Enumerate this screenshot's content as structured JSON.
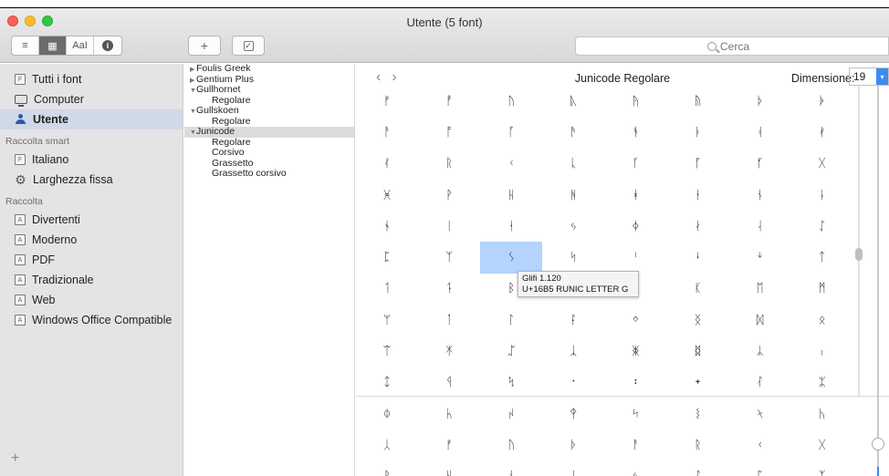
{
  "window": {
    "title": "Utente (5 font)"
  },
  "toolbar": {
    "view_modes": [
      "≡",
      "▦",
      "AaI",
      "i"
    ],
    "add_label": "+",
    "search": {
      "placeholder": "Cerca"
    }
  },
  "sidebar": {
    "items_top": [
      {
        "label": "Tutti i font",
        "icon": "font-file-icon"
      },
      {
        "label": "Computer",
        "icon": "computer-icon"
      },
      {
        "label": "Utente",
        "icon": "user-icon",
        "selected": true
      }
    ],
    "smart_title": "Raccolta smart",
    "smart_items": [
      {
        "label": "Italiano",
        "icon": "font-file-icon"
      },
      {
        "label": "Larghezza fissa",
        "icon": "gear-icon"
      }
    ],
    "collection_title": "Raccolta",
    "collection_items": [
      {
        "label": "Divertenti"
      },
      {
        "label": "Moderno"
      },
      {
        "label": "PDF"
      },
      {
        "label": "Tradizionale"
      },
      {
        "label": "Web"
      },
      {
        "label": "Windows Office Compatible"
      }
    ],
    "add_label": "+"
  },
  "font_list": [
    {
      "type": "family",
      "label": "Foulis Greek",
      "expanded": false
    },
    {
      "type": "family",
      "label": "Gentium Plus",
      "expanded": false
    },
    {
      "type": "family",
      "label": "Gullhornet",
      "expanded": true
    },
    {
      "type": "style",
      "label": "Regolare"
    },
    {
      "type": "family",
      "label": "Gullskoen",
      "expanded": true
    },
    {
      "type": "style",
      "label": "Regolare"
    },
    {
      "type": "family",
      "label": "Junicode",
      "expanded": true,
      "selected": true
    },
    {
      "type": "style",
      "label": "Regolare"
    },
    {
      "type": "style",
      "label": "Corsivo"
    },
    {
      "type": "style",
      "label": "Grassetto"
    },
    {
      "type": "style",
      "label": "Grassetto corsivo"
    }
  ],
  "preview": {
    "nav_prev": "‹",
    "nav_next": "›",
    "font_name": "Junicode Regolare",
    "size_label": "Dimensione:",
    "size_value": "19",
    "glyph_rows": [
      [
        "ᚠ",
        "ᚡ",
        "ᚢ",
        "ᚣ",
        "ᚤ",
        "ᚥ",
        "ᚦ",
        "ᚧ"
      ],
      [
        "ᚨ",
        "ᚩ",
        "ᚪ",
        "ᚫ",
        "ᚬ",
        "ᚭ",
        "ᚮ",
        "ᚯ"
      ],
      [
        "ᚰ",
        "ᚱ",
        "ᚲ",
        "ᚳ",
        "ᚴ",
        "ᚵ",
        "ᚶ",
        "ᚷ"
      ],
      [
        "ᚸ",
        "ᚹ",
        "ᚺ",
        "ᚻ",
        "ᚼ",
        "ᚽ",
        "ᚾ",
        "ᚿ"
      ],
      [
        "ᛀ",
        "ᛁ",
        "ᛂ",
        "ᛃ",
        "ᛄ",
        "ᛅ",
        "ᛆ",
        "ᛇ"
      ],
      [
        "ᛈ",
        "ᛉ",
        "ᛊ",
        "ᛋ",
        "ᛌ",
        "ᛍ",
        "ᛎ",
        "ᛏ"
      ],
      [
        "ᛐ",
        "ᛑ",
        "ᛒ",
        "ᛓ",
        "ᛔ",
        "ᛕ",
        "ᛖ",
        "ᛗ"
      ],
      [
        "ᛘ",
        "ᛙ",
        "ᛚ",
        "ᛛ",
        "ᛜ",
        "ᛝ",
        "ᛞ",
        "ᛟ"
      ],
      [
        "ᛠ",
        "ᛡ",
        "ᛢ",
        "ᛣ",
        "ᛤ",
        "ᛥ",
        "ᛦ",
        "ᛧ"
      ],
      [
        "ᛨ",
        "ᛩ",
        "ᛪ",
        "᛫",
        "᛬",
        "᛭",
        "ᛮ",
        "ᛯ"
      ],
      [
        "ᛰ",
        "ᛱ",
        "ᛲ",
        "ᛳ",
        "ᛴ",
        "ᛵ",
        "ᛶ",
        "ᛷ"
      ],
      [
        "ᛸ",
        "ᚠ",
        "ᚢ",
        "ᚦ",
        "ᚨ",
        "ᚱ",
        "ᚲ",
        "ᚷ"
      ],
      [
        "ᚹ",
        "ᚺ",
        "ᚾ",
        "ᛁ",
        "ᛃ",
        "ᛇ",
        "ᛈ",
        "ᛉ"
      ]
    ],
    "selected_cell": [
      5,
      2
    ],
    "tooltip_line1": "Glifi 1.120",
    "tooltip_line2": "U+16B5 RUNIC LETTER G"
  },
  "colors": {
    "accent": "#3b8cf2",
    "selection": "#b3d4fc",
    "sidebar_bg": "#e4e3e5"
  }
}
